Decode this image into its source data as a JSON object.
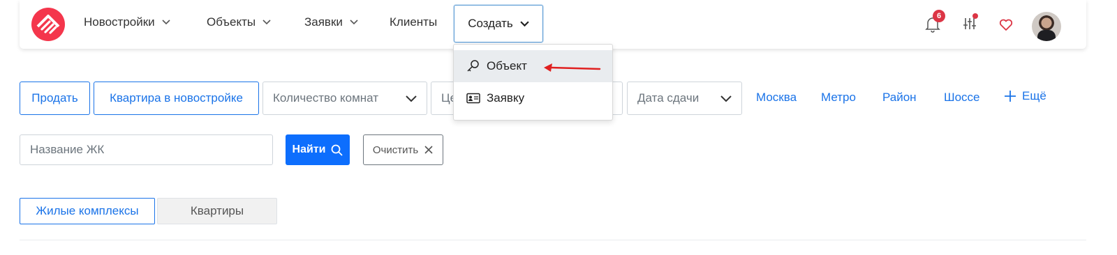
{
  "nav": {
    "items": [
      {
        "label": "Новостройки"
      },
      {
        "label": "Объекты"
      },
      {
        "label": "Заявки"
      },
      {
        "label": "Клиенты"
      }
    ],
    "create_label": "Создать",
    "notifications_count": "6"
  },
  "dropdown": {
    "items": [
      {
        "label": "Объект",
        "icon": "key-icon"
      },
      {
        "label": "Заявку",
        "icon": "id-card-icon"
      }
    ]
  },
  "filters": {
    "sell": "Продать",
    "type": "Квартира в новостройке",
    "rooms_placeholder": "Количество комнат",
    "price_placeholder_visible": "Це",
    "date_placeholder": "Дата сдачи",
    "links": [
      "Москва",
      "Метро",
      "Район",
      "Шоссе"
    ],
    "more": "Ещё",
    "name_placeholder": "Название ЖК",
    "find": "Найти",
    "clear": "Очистить"
  },
  "tabs": {
    "complexes": "Жилые комплексы",
    "apartments": "Квартиры"
  },
  "colors": {
    "accent": "#1a73e8",
    "brand": "#f4364c",
    "badge": "#dc3545",
    "primary_button": "#0d6efd"
  }
}
